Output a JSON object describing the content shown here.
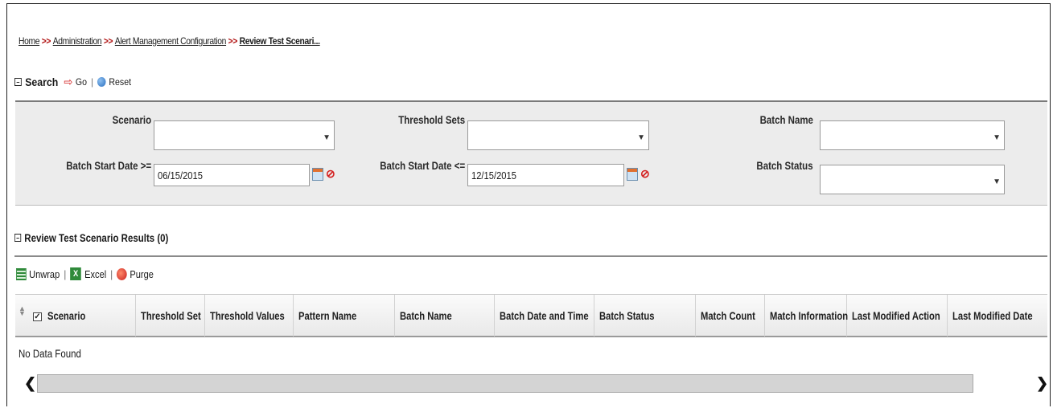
{
  "breadcrumb": {
    "items": [
      "Home",
      "Administration",
      "Alert Management Configuration"
    ],
    "current": "Review Test Scenari...",
    "separator": ">>"
  },
  "search_toolbar": {
    "title": "Search",
    "go_label": "Go",
    "reset_label": "Reset"
  },
  "search_form": {
    "scenario_label": "Scenario",
    "scenario_value": "",
    "threshold_sets_label": "Threshold Sets",
    "threshold_sets_value": "",
    "batch_name_label": "Batch Name",
    "batch_name_value": "",
    "batch_start_from_label": "Batch Start Date >=",
    "batch_start_from_value": "06/15/2015",
    "batch_start_to_label": "Batch Start Date <=",
    "batch_start_to_value": "12/15/2015",
    "batch_status_label": "Batch Status",
    "batch_status_value": ""
  },
  "results": {
    "title": "Review Test Scenario Results (0)",
    "unwrap_label": "Unwrap",
    "excel_label": "Excel",
    "purge_label": "Purge",
    "columns": [
      "Scenario",
      "Threshold Set",
      "Threshold Values",
      "Pattern Name",
      "Batch Name",
      "Batch Date and Time",
      "Batch Status",
      "Match Count",
      "Match Information",
      "Last Modified Action",
      "Last Modified Date"
    ],
    "empty_text": "No Data Found"
  },
  "colors": {
    "accent_red": "#d42020",
    "panel_bg": "#ececec"
  }
}
